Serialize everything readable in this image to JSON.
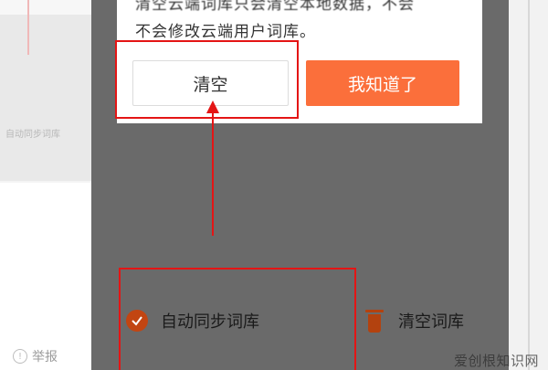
{
  "background_page": {
    "side_caption": "自动同步词库",
    "report_label": "举报",
    "report_icon": "info-circle-icon"
  },
  "dialog": {
    "line1": "清空云端词库只会清空本地数据，不会",
    "line2": "不会修改云端用户词库。",
    "clear_button": "清空",
    "ok_button": "我知道了",
    "accent_color": "#fb6f3b"
  },
  "toolbar": {
    "sync_label": "自动同步词库",
    "sync_icon": "check-circle-icon",
    "clear_label": "清空词库",
    "clear_icon": "trash-icon"
  },
  "annotation": {
    "highlight_color": "#e41515"
  },
  "watermark": "爱创根知识网"
}
